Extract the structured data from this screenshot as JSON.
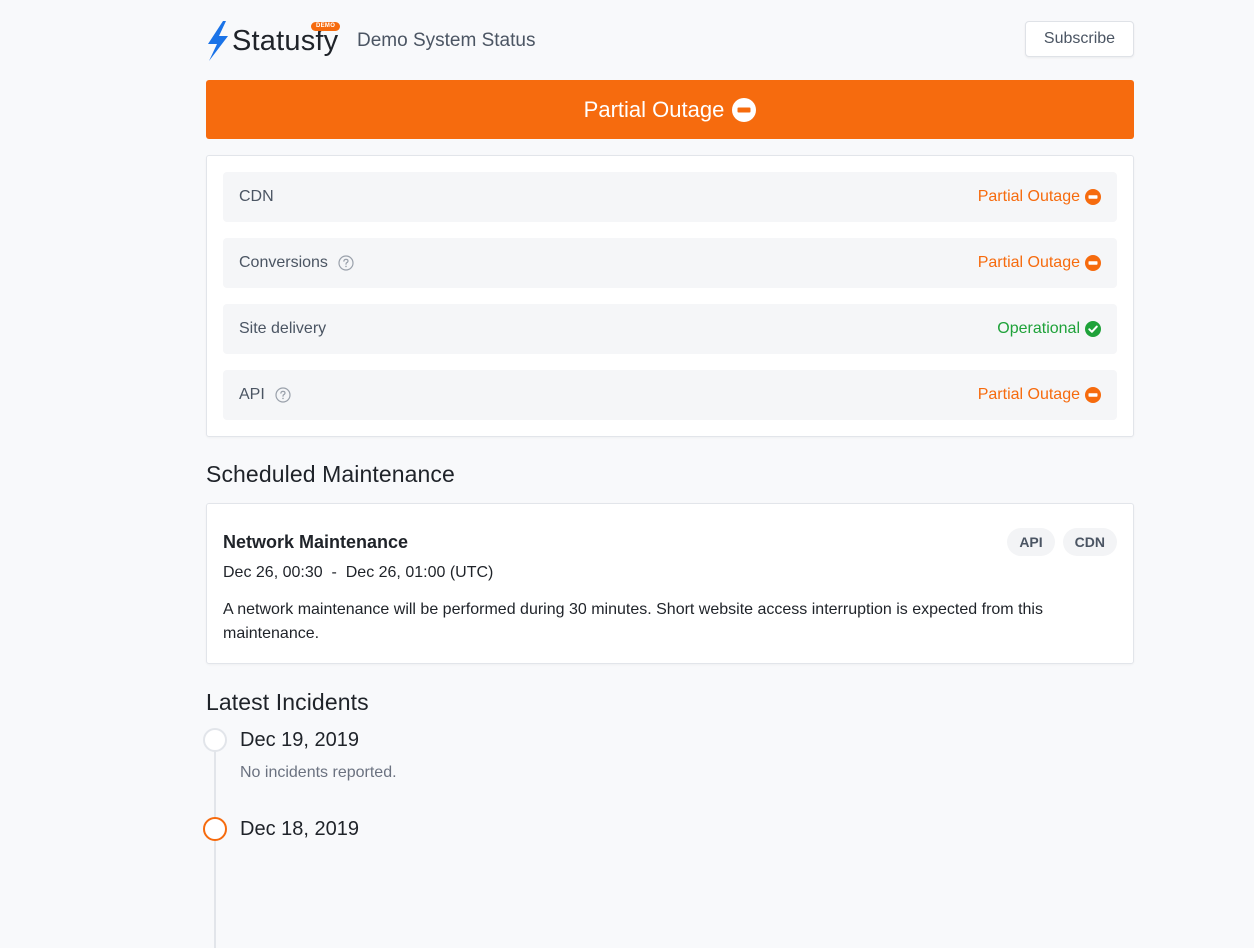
{
  "header": {
    "brand": "Statusfy",
    "brand_badge": "DEMO",
    "site_title": "Demo System Status",
    "subscribe_label": "Subscribe"
  },
  "overall_status": {
    "label": "Partial Outage",
    "icon": "minus-circle-icon",
    "color": "#f66b0e"
  },
  "components": [
    {
      "name": "CDN",
      "has_help": false,
      "status": "Partial Outage",
      "status_type": "partial"
    },
    {
      "name": "Conversions",
      "has_help": true,
      "status": "Partial Outage",
      "status_type": "partial"
    },
    {
      "name": "Site delivery",
      "has_help": false,
      "status": "Operational",
      "status_type": "operational"
    },
    {
      "name": "API",
      "has_help": true,
      "status": "Partial Outage",
      "status_type": "partial"
    }
  ],
  "status_colors": {
    "partial": "#f66b0e",
    "operational": "#1fa23a"
  },
  "scheduled_maintenance": {
    "section_title": "Scheduled Maintenance",
    "items": [
      {
        "title": "Network Maintenance",
        "tags": [
          "API",
          "CDN"
        ],
        "start": "Dec 26, 00:30",
        "separator": "-",
        "end": "Dec 26, 01:00",
        "timezone": "(UTC)",
        "description": "A network maintenance will be performed during 30 minutes. Short website access interruption is expected from this maintenance."
      }
    ]
  },
  "incidents": {
    "section_title": "Latest Incidents",
    "days": [
      {
        "date": "Dec 19, 2019",
        "note": "No incidents reported.",
        "marker": "none"
      },
      {
        "date": "Dec 18, 2019",
        "note": "",
        "marker": "partial"
      }
    ]
  }
}
